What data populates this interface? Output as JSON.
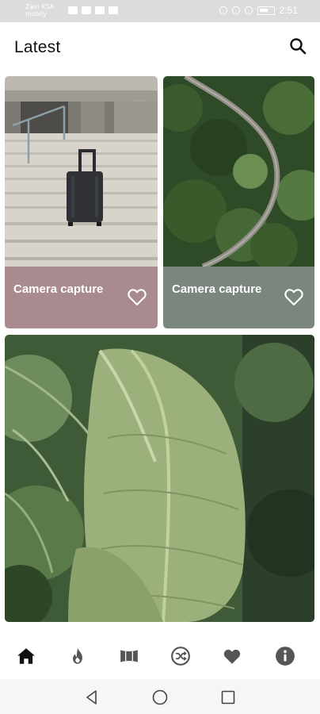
{
  "status_bar": {
    "carrier_line1": "Zain KSA",
    "carrier_line2": "mobily",
    "time": "2:51"
  },
  "header": {
    "title": "Latest",
    "search_icon": "search-icon"
  },
  "cards": [
    {
      "title": "Camera capture",
      "favorite": false,
      "footer_color": "#a98a8f",
      "image": "stairs-luggage-photo"
    },
    {
      "title": "Camera capture",
      "favorite": false,
      "footer_color": "#7b867e",
      "image": "forest-road-photo"
    },
    {
      "image": "banana-leaves-photo"
    }
  ],
  "bottom_nav": {
    "items": [
      {
        "icon": "home-icon",
        "active": true
      },
      {
        "icon": "fire-icon",
        "active": false
      },
      {
        "icon": "panorama-icon",
        "active": false
      },
      {
        "icon": "shuffle-icon",
        "active": false
      },
      {
        "icon": "heart-icon",
        "active": false
      },
      {
        "icon": "info-icon",
        "active": false
      }
    ]
  },
  "system_nav": {
    "items": [
      {
        "icon": "back-icon"
      },
      {
        "icon": "home-circle-icon"
      },
      {
        "icon": "recents-icon"
      }
    ]
  },
  "colors": {
    "accent_dark": "#111111",
    "nav_inactive": "#555555",
    "card1_footer": "#a98a8f",
    "card2_footer": "#7b867e"
  }
}
